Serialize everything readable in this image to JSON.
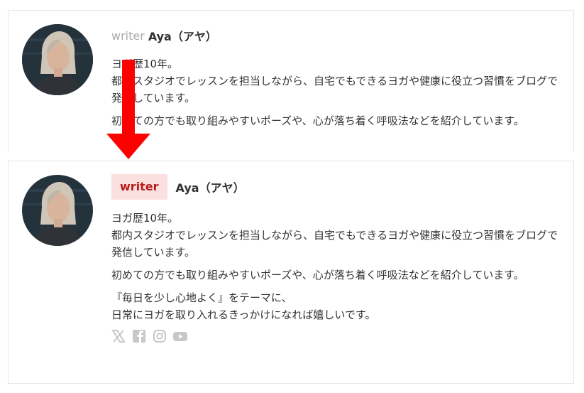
{
  "before": {
    "role": "writer",
    "name": "Aya（アヤ）",
    "bio": [
      "ヨガ歴10年。\n都内スタジオでレッスンを担当しながら、自宅でもできるヨガや健康に役立つ習慣をブログで発信しています。",
      "初めての方でも取り組みやすいポーズや、心が落ち着く呼吸法などを紹介しています。"
    ]
  },
  "after": {
    "role": "writer",
    "name": "Aya（アヤ）",
    "bio": [
      "ヨガ歴10年。\n都内スタジオでレッスンを担当しながら、自宅でもできるヨガや健康に役立つ習慣をブログで発信しています。",
      "初めての方でも取り組みやすいポーズや、心が落ち着く呼吸法などを紹介しています。",
      "『毎日を少し心地よく』をテーマに、\n日常にヨガを取り入れるきっかけになれば嬉しいです。"
    ],
    "social": [
      "x-icon",
      "facebook-icon",
      "instagram-icon",
      "youtube-icon"
    ]
  },
  "colors": {
    "arrow": "#ff0000",
    "badge_bg": "#fbe0e0",
    "badge_text": "#b71c1c",
    "social_icon": "#c8c8c8"
  }
}
